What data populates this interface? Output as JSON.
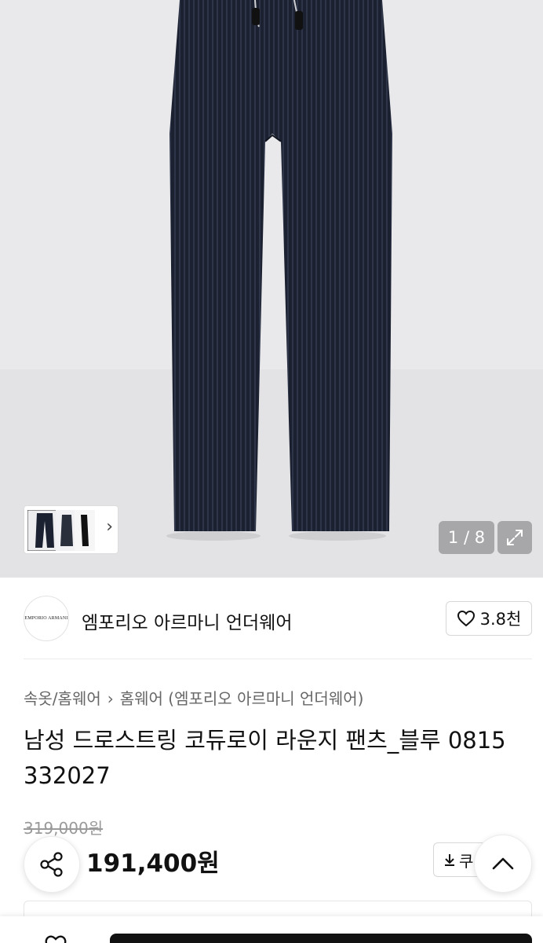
{
  "gallery": {
    "counter": "1 / 8",
    "thumbnail_arrow": "›"
  },
  "brand": {
    "logo_text": "EMPORIO ARMANI",
    "name": "엠포리오 아르마니 언더웨어",
    "likes": "3.8천"
  },
  "breadcrumb": {
    "level1": "속옷/홈웨어",
    "separator": "›",
    "level2": "홈웨어 (엠포리오 아르마니 언더웨어)"
  },
  "product": {
    "title_line1": "남성 드로스트링 코듀로이 라운지 팬츠_블루 0815",
    "title_line2": "332027",
    "original_price": "319,000원",
    "sale_price": "191,400원"
  },
  "actions": {
    "coupon_label": "쿠"
  },
  "colors": {
    "pants": "#1b2130",
    "background": "#e9e9eb",
    "overlay": "#a7a7aa"
  }
}
